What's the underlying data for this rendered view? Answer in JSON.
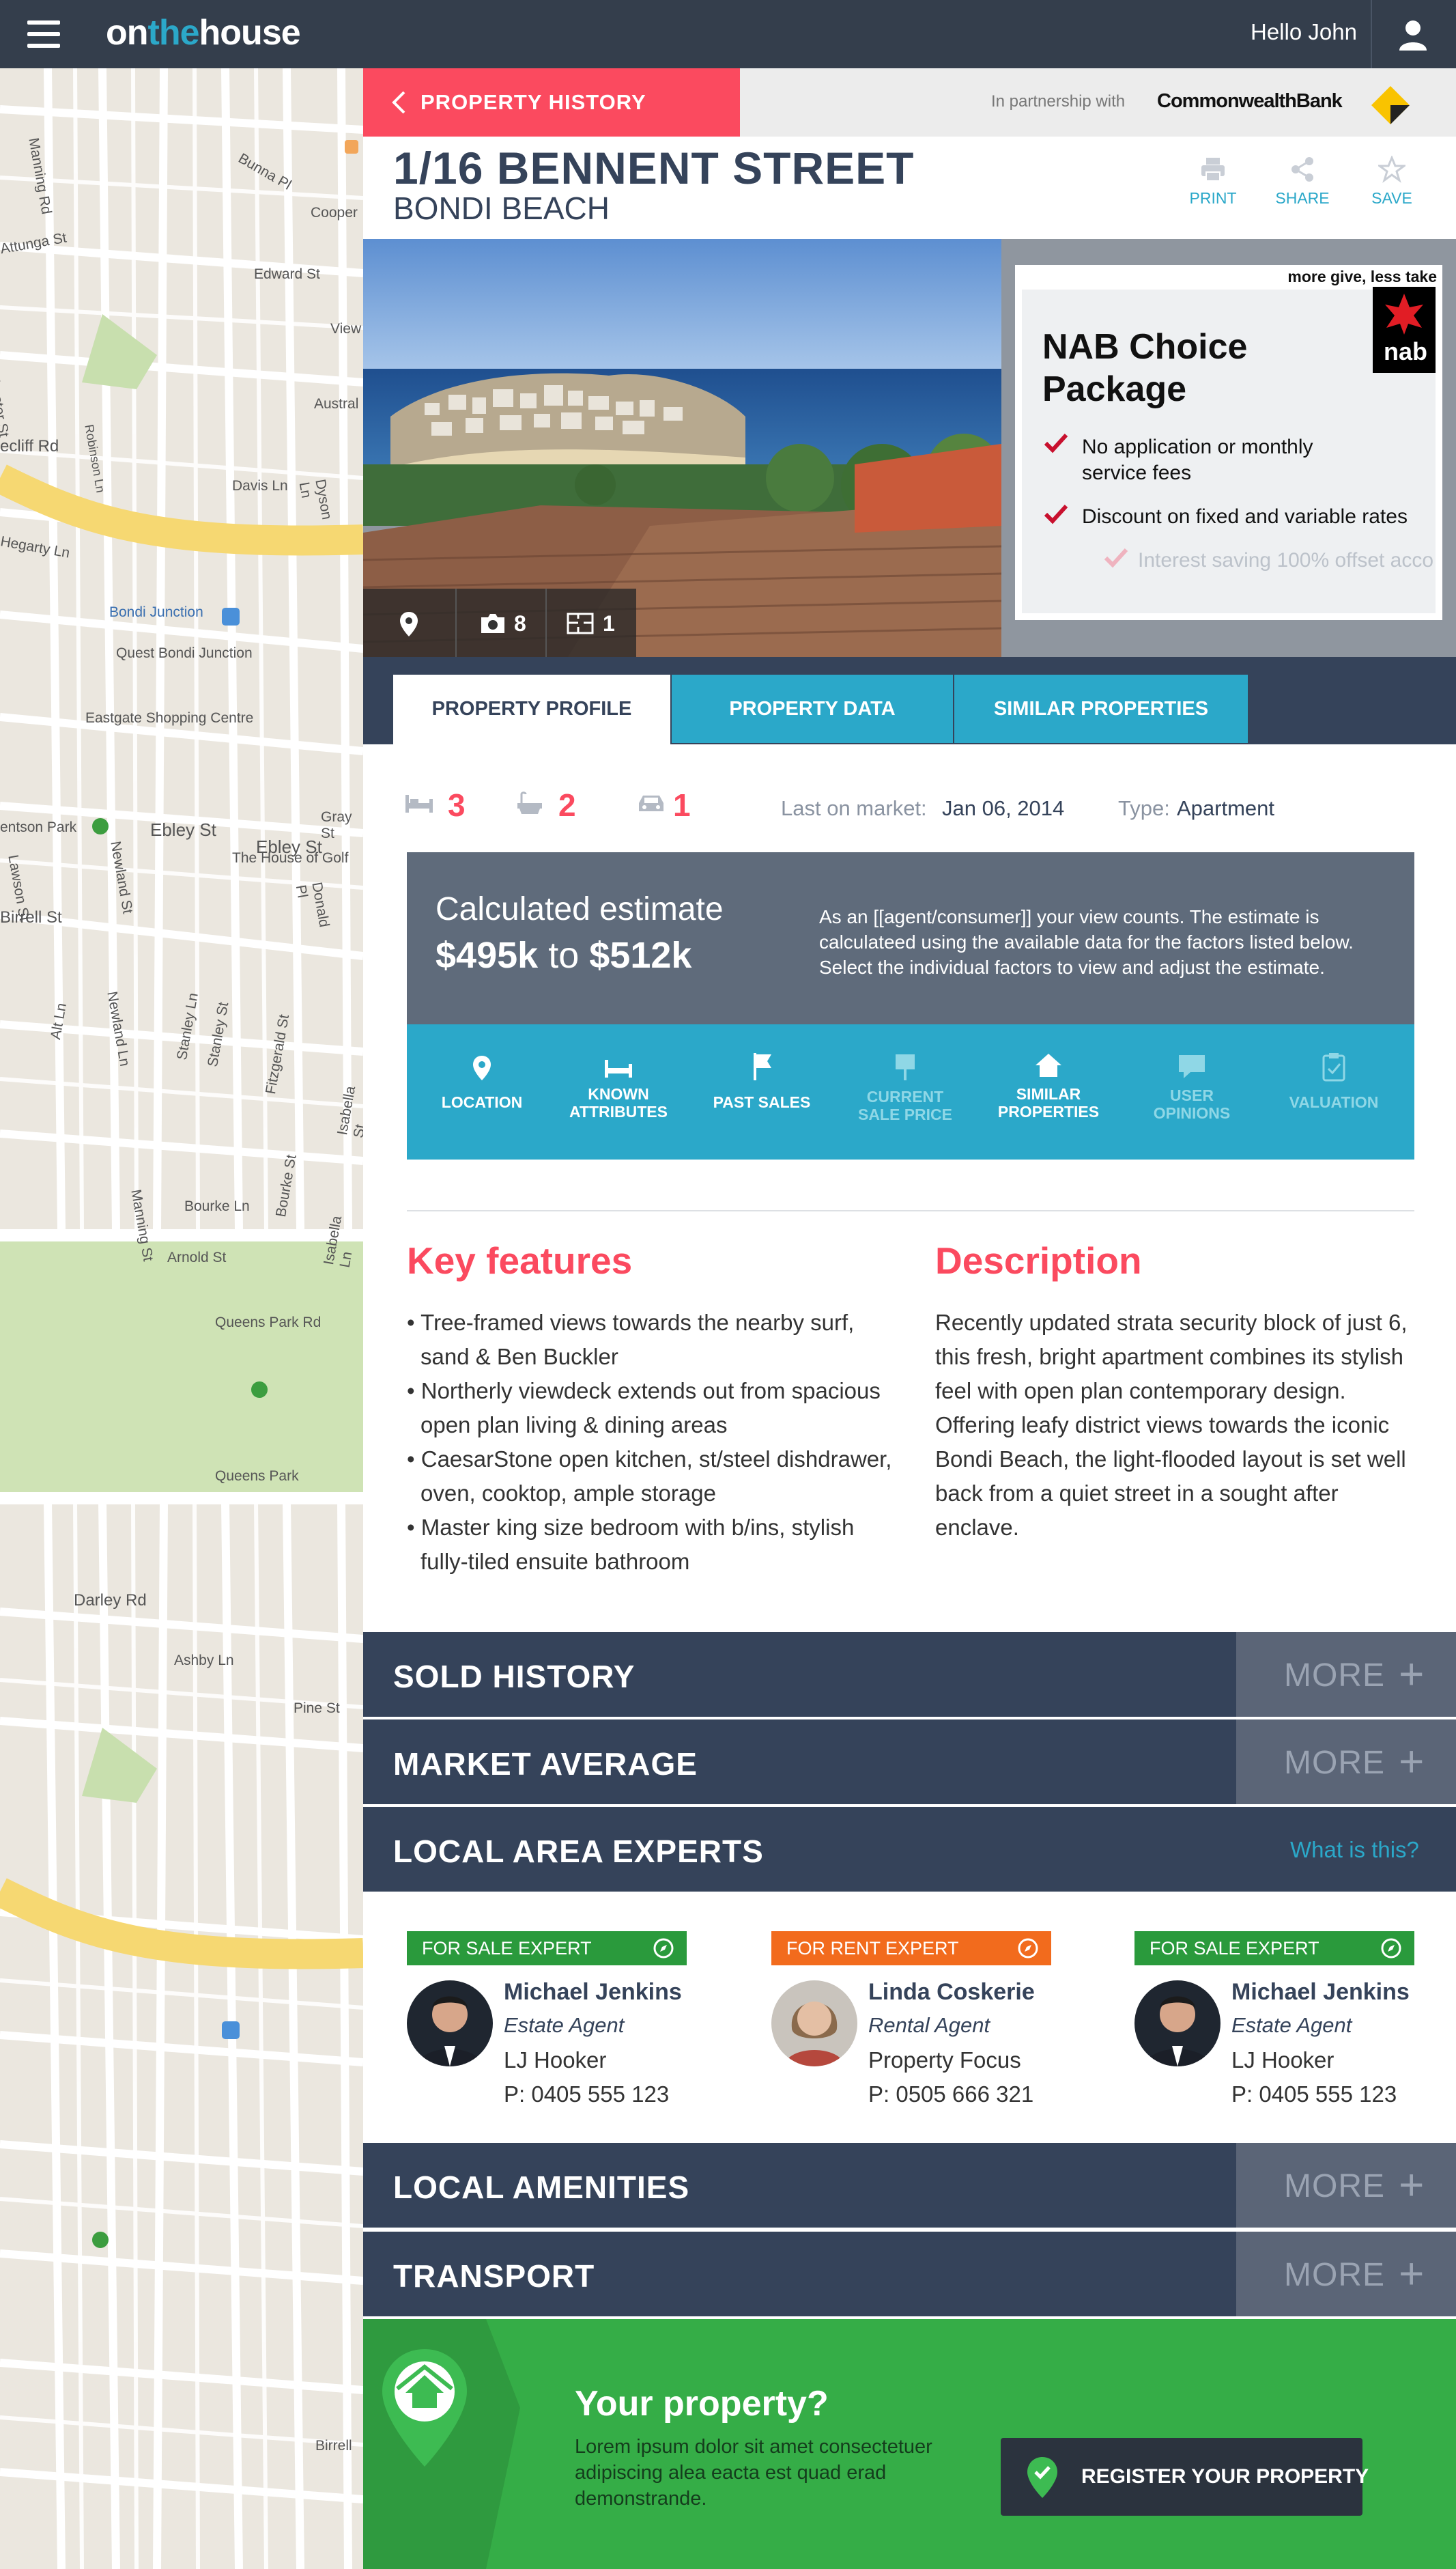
{
  "brand": {
    "logo_parts": [
      "on",
      "the",
      "house"
    ],
    "greeting": "Hello John",
    "accent": "#fb4a5f",
    "teal": "#2ba8c9",
    "navy": "#35435a",
    "green": "#35ad47"
  },
  "map": {
    "labels": [
      "Manning Rd",
      "Bunna Pl",
      "Cooper",
      "Attunga St",
      "Edward St",
      "Chester St",
      "View",
      "Austral",
      "Robinson Ln",
      "ecliff Rd",
      "Davis Ln",
      "Dyson Ln",
      "Hegarty Ln",
      "Bondi Junction",
      "Quest Bondi Junction",
      "Eastgate Shopping Centre",
      "entson Park",
      "Ebley St",
      "Ebley St",
      "Gray St",
      "The House of Golf",
      "Birrell St",
      "Donald Pl",
      "Newland St",
      "Lawson St",
      "Alt Ln",
      "Newland Ln",
      "Stanley Ln",
      "Stanley St",
      "Fitzgerald St",
      "Isabella Ln",
      "Isabella St",
      "Bourke Ln",
      "Bourke St",
      "Manning St",
      "Arnold St",
      "Queens Park Rd",
      "Queens Park",
      "Darley Rd",
      "Ashby Ln",
      "Pine St",
      "Birrell"
    ]
  },
  "header": {
    "back_label": "PROPERTY HISTORY",
    "partnership_text": "In partnership with",
    "partner_name": "CommonwealthBank",
    "address_line1": "1/16 BENNENT STREET",
    "address_line2": "BONDI BEACH",
    "actions": [
      "PRINT",
      "SHARE",
      "SAVE"
    ]
  },
  "photo": {
    "photo_count": "8",
    "floorplan_count": "1"
  },
  "ad": {
    "tagline": "more give, less take",
    "logo_text": "nab",
    "title_line1": "NAB Choice",
    "title_line2": "Package",
    "bullets": [
      "No application or monthly service fees",
      "Discount on fixed and variable rates",
      "Interest saving 100% offset acco"
    ]
  },
  "tabs": [
    "PROPERTY PROFILE",
    "PROPERTY DATA",
    "SIMILAR PROPERTIES"
  ],
  "summary": {
    "beds": "3",
    "baths": "2",
    "cars": "1",
    "last_market_label": "Last on market:",
    "last_market_value": "Jan 06, 2014",
    "type_label": "Type:",
    "type_value": "Apartment"
  },
  "estimate": {
    "title": "Calculated estimate",
    "low": "$495k",
    "to": "to",
    "high": "$512k",
    "note": "As an [[agent/consumer]] your view counts. The estimate is calculateed using the available data for the factors listed below. Select the individual factors to view and adjust the estimate."
  },
  "factors": [
    {
      "line1": "LOCATION",
      "line2": "",
      "icon": "location-pin-icon",
      "active": true
    },
    {
      "line1": "KNOWN",
      "line2": "ATTRIBUTES",
      "icon": "bed-icon",
      "active": true
    },
    {
      "line1": "PAST SALES",
      "line2": "",
      "icon": "sign-icon",
      "active": true
    },
    {
      "line1": "CURRENT",
      "line2": "SALE PRICE",
      "icon": "sign-post-icon",
      "active": false
    },
    {
      "line1": "SIMILAR",
      "line2": "PROPERTIES",
      "icon": "home-icon",
      "active": true
    },
    {
      "line1": "USER",
      "line2": "OPINIONS",
      "icon": "speech-bubble-icon",
      "active": false
    },
    {
      "line1": "VALUATION",
      "line2": "",
      "icon": "clipboard-icon",
      "active": false
    }
  ],
  "key_features": {
    "title": "Key features",
    "items": [
      "Tree-framed views towards the nearby surf, sand & Ben Buckler",
      "Northerly viewdeck extends out from spacious open plan living & dining areas",
      "CaesarStone open kitchen, st/steel dishdrawer, oven, cooktop, ample storage",
      "Master king size bedroom with b/ins, stylish fully-tiled ensuite bathroom"
    ]
  },
  "description": {
    "title": "Description",
    "text": "Recently updated strata security block of just 6, this fresh, bright apartment combines its stylish feel with open plan contemporary design. Offering leafy district views towards the iconic Bondi Beach, the light-flooded layout is set well back from a quiet street in a sought after enclave."
  },
  "sections": {
    "sold_history": "SOLD HISTORY",
    "market_average": "MARKET AVERAGE",
    "local_experts": "LOCAL AREA EXPERTS",
    "what_is_this": "What is this?",
    "local_amenities": "LOCAL AMENITIES",
    "transport": "TRANSPORT",
    "more": "MORE"
  },
  "experts": [
    {
      "badge": "FOR SALE EXPERT",
      "badge_color": "#2a9a3c",
      "name": "Michael Jenkins",
      "role": "Estate Agent",
      "agency": "LJ Hooker",
      "phone": "P: 0405 555 123"
    },
    {
      "badge": "FOR RENT EXPERT",
      "badge_color": "#f26b1d",
      "name": "Linda Coskerie",
      "role": "Rental Agent",
      "agency": "Property Focus",
      "phone": "P: 0505 666 321"
    },
    {
      "badge": "FOR SALE EXPERT",
      "badge_color": "#2a9a3c",
      "name": "Michael Jenkins",
      "role": "Estate Agent",
      "agency": "LJ Hooker",
      "phone": "P: 0405 555 123"
    }
  ],
  "cta": {
    "title": "Your property?",
    "text": "Lorem ipsum dolor sit amet consectetuer adipiscing alea eacta est quad erad demonstrande.",
    "button": "REGISTER YOUR PROPERTY"
  }
}
